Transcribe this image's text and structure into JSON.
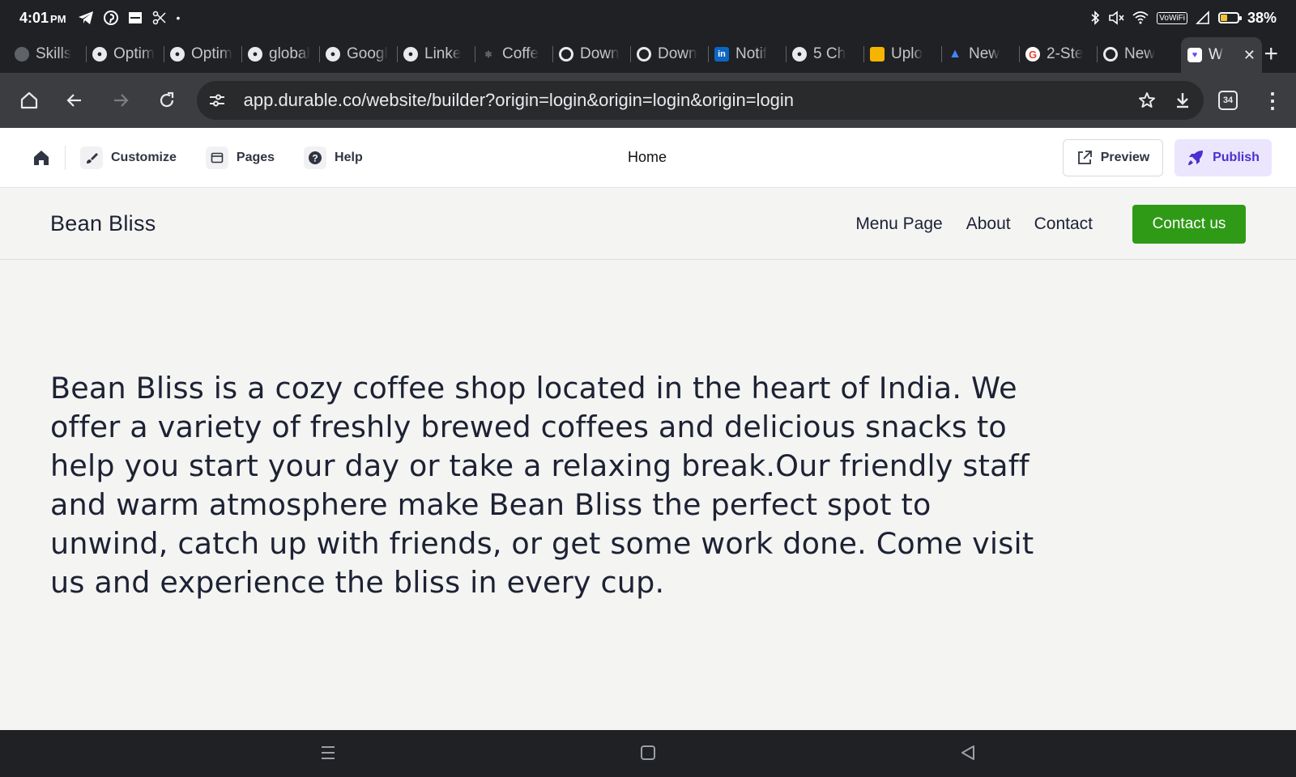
{
  "status_bar": {
    "time": "4:01",
    "ampm": "PM",
    "network_label": "VoWiFi",
    "battery": "38%"
  },
  "tabs": [
    {
      "label": "Skills",
      "icon": "globe-icon"
    },
    {
      "label": "Optim",
      "icon": "globe-icon"
    },
    {
      "label": "Optim",
      "icon": "globe-icon"
    },
    {
      "label": "global",
      "icon": "globe-icon"
    },
    {
      "label": "Googl",
      "icon": "globe-icon"
    },
    {
      "label": "Linke",
      "icon": "globe-icon"
    },
    {
      "label": "Coffe",
      "icon": "coffee-icon"
    },
    {
      "label": "Down",
      "icon": "chrome-icon"
    },
    {
      "label": "Down",
      "icon": "chrome-icon"
    },
    {
      "label": "Notif",
      "icon": "linkedin-icon"
    },
    {
      "label": "5 Ch",
      "icon": "globe-icon"
    },
    {
      "label": "Uplo",
      "icon": "upload-icon"
    },
    {
      "label": "New",
      "icon": "ads-icon"
    },
    {
      "label": "2-Ste",
      "icon": "google-icon"
    },
    {
      "label": "New",
      "icon": "chrome-icon"
    }
  ],
  "active_tab": {
    "label": "W",
    "icon": "durable-icon"
  },
  "address": {
    "url": "app.durable.co/website/builder?origin=login&origin=login&origin=login",
    "tab_count": "34"
  },
  "builder": {
    "customize": "Customize",
    "pages": "Pages",
    "help": "Help",
    "current_page": "Home",
    "preview": "Preview",
    "publish": "Publish"
  },
  "site": {
    "name": "Bean Bliss",
    "nav": [
      "Menu Page",
      "About",
      "Contact"
    ],
    "cta": "Contact us",
    "about": "Bean Bliss is a cozy coffee shop located in the heart of India. We offer a variety of freshly brewed coffees and delicious snacks to help you start your day or take a relaxing break.Our friendly staff and warm atmosphere make Bean Bliss the perfect spot to unwind, catch up with friends, or get some work done. Come visit us and experience the bliss in every cup."
  },
  "colors": {
    "cta_green": "#2f9a16",
    "publish_purple": "#4b2fd1",
    "publish_bg": "#ebe6fd",
    "chrome_dark": "#202124"
  }
}
